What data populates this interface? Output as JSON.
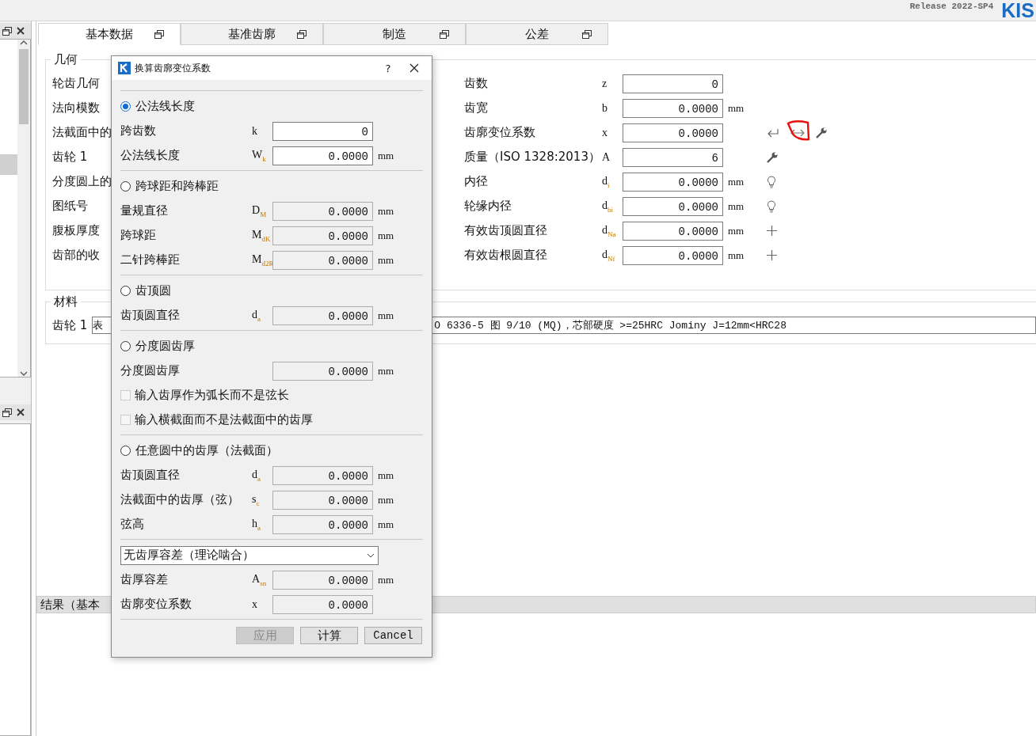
{
  "header": {
    "release": "Release 2022-SP4",
    "logo": "KIS"
  },
  "tabs": [
    {
      "label": "基本数据",
      "selected": true
    },
    {
      "label": "基准齿廓",
      "selected": false
    },
    {
      "label": "制造",
      "selected": false
    },
    {
      "label": "公差",
      "selected": false
    }
  ],
  "geometry": {
    "title": "几何",
    "left_labels": [
      "轮齿几何",
      "法向模数",
      "法截面中的",
      "齿轮 1",
      "分度圆上的",
      "图纸号",
      "腹板厚度",
      "齿部的收"
    ],
    "rows": [
      {
        "label": "齿数",
        "symbol": "z",
        "value": "0",
        "kind": "none",
        "marked": false
      },
      {
        "label": "齿宽",
        "symbol": "b",
        "value": "0.0000",
        "unit": "mm",
        "kind": "none",
        "marked": false
      },
      {
        "label": "齿廓变位系数",
        "symbol": "x",
        "value": "0.0000",
        "kind": "shift",
        "marked": true
      },
      {
        "label": "质量（ISO 1328:2013）",
        "symbol": "A",
        "value": "6",
        "kind": "quality",
        "marked": false
      },
      {
        "label": "内径",
        "symbol": "d$_{i}$",
        "value": "0.0000",
        "unit": "mm",
        "kind": "bulb",
        "marked": false
      },
      {
        "label": "轮缘内径",
        "symbol": "d$_{bi}$",
        "value": "0.0000",
        "unit": "mm",
        "kind": "bulb",
        "marked": false
      },
      {
        "label": "有效齿顶圆直径",
        "symbol": "d$_{Na}$",
        "value": "0.0000",
        "unit": "mm",
        "kind": "plus",
        "marked": false
      },
      {
        "label": "有效齿根圆直径",
        "symbol": "d$_{Nf}$",
        "value": "0.0000",
        "unit": "mm",
        "kind": "plus",
        "marked": false
      }
    ]
  },
  "material": {
    "title": "材料",
    "label": "齿轮 1",
    "value_start": "表",
    "value_end": "O 6336-5 图 9/10 (MQ)，芯部硬度 >=25HRC Jominy J=12mm<HRC28"
  },
  "results": {
    "title": "结果（基本"
  },
  "dialog": {
    "title": "换算齿廓变位系数",
    "help": "?",
    "sections": [
      {
        "kind": "radio",
        "label": "公法线长度",
        "selected": true,
        "rows": [
          {
            "kind": "field",
            "label": "跨齿数",
            "symbol": "k",
            "value": "0",
            "disabled": false
          },
          {
            "kind": "field",
            "label": "公法线长度",
            "symbol": "W$_{k}$",
            "value": "0.0000",
            "unit": "mm",
            "disabled": false
          }
        ]
      },
      {
        "kind": "radio",
        "label": "跨球距和跨棒距",
        "selected": false,
        "rows": [
          {
            "kind": "field",
            "label": "量规直径",
            "symbol": "D$_{M}$",
            "value": "0.0000",
            "unit": "mm",
            "disabled": true
          },
          {
            "kind": "field",
            "label": "跨球距",
            "symbol": "M$_{dK}$",
            "value": "0.0000",
            "unit": "mm",
            "disabled": true
          },
          {
            "kind": "field",
            "label": "二针跨棒距",
            "symbol": "M$_{d2R}$",
            "value": "0.0000",
            "unit": "mm",
            "disabled": true
          }
        ]
      },
      {
        "kind": "radio",
        "label": "齿顶圆",
        "selected": false,
        "rows": [
          {
            "kind": "field",
            "label": "齿顶圆直径",
            "symbol": "d$_{a}$",
            "value": "0.0000",
            "unit": "mm",
            "disabled": true
          }
        ]
      },
      {
        "kind": "radio",
        "label": "分度圆齿厚",
        "selected": false,
        "rows": [
          {
            "kind": "field",
            "label": "分度圆齿厚",
            "value": "0.0000",
            "unit": "mm",
            "disabled": true
          },
          {
            "kind": "checkbox",
            "label": "输入齿厚作为弧长而不是弦长",
            "checked": false,
            "disabled": true
          },
          {
            "kind": "checkbox",
            "label": "输入横截面而不是法截面中的齿厚",
            "checked": false,
            "disabled": true
          }
        ]
      },
      {
        "kind": "radio",
        "label": "任意圆中的齿厚（法截面）",
        "selected": false,
        "rows": [
          {
            "kind": "field",
            "label": "齿顶圆直径",
            "symbol": "d$_{a}$",
            "value": "0.0000",
            "unit": "mm",
            "disabled": true
          },
          {
            "kind": "field",
            "label": "法截面中的齿厚（弦）",
            "symbol": "s$_{c}$",
            "value": "0.0000",
            "unit": "mm",
            "disabled": true
          },
          {
            "kind": "field",
            "label": "弦高",
            "symbol": "h$_{a}$",
            "value": "0.0000",
            "unit": "mm",
            "disabled": true
          }
        ]
      },
      {
        "kind": "dropdown",
        "value": "无齿厚容差（理论啮合）",
        "rows": [
          {
            "kind": "field",
            "label": "齿厚容差",
            "symbol": "A$_{sn}$",
            "value": "0.0000",
            "unit": "mm",
            "disabled": true
          },
          {
            "kind": "field",
            "label": "齿廓变位系数",
            "symbol": "x",
            "value": "0.0000",
            "disabled": true
          }
        ]
      }
    ],
    "buttons": [
      {
        "label": "应用",
        "disabled": true
      },
      {
        "label": "计算",
        "disabled": false
      },
      {
        "label": "Cancel",
        "disabled": false
      }
    ]
  }
}
